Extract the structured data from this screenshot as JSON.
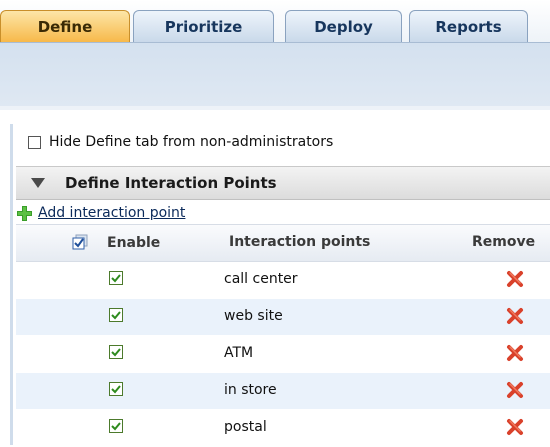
{
  "tabs": [
    {
      "label": "Define",
      "active": true
    },
    {
      "label": "Prioritize",
      "active": false
    },
    {
      "label": "Deploy",
      "active": false
    },
    {
      "label": "Reports",
      "active": false
    }
  ],
  "hide_define": {
    "label": "Hide Define tab from non-administrators",
    "checked": false
  },
  "section": {
    "title": "Define Interaction Points",
    "expanded": true
  },
  "add_link": {
    "label": "Add interaction point",
    "icon": "plus-icon"
  },
  "table": {
    "headers": {
      "enable": "Enable",
      "points": "Interaction points",
      "remove": "Remove"
    },
    "rows": [
      {
        "enabled": true,
        "name": "call center"
      },
      {
        "enabled": true,
        "name": "web site"
      },
      {
        "enabled": true,
        "name": "ATM"
      },
      {
        "enabled": true,
        "name": "in store"
      },
      {
        "enabled": true,
        "name": "postal"
      }
    ]
  },
  "colors": {
    "active_tab": "#f7b94a",
    "inactive_tab": "#c9d9ea",
    "row_alt": "#eaf2fb",
    "remove_red": "#d9412b",
    "check_green": "#2e8b1e"
  }
}
